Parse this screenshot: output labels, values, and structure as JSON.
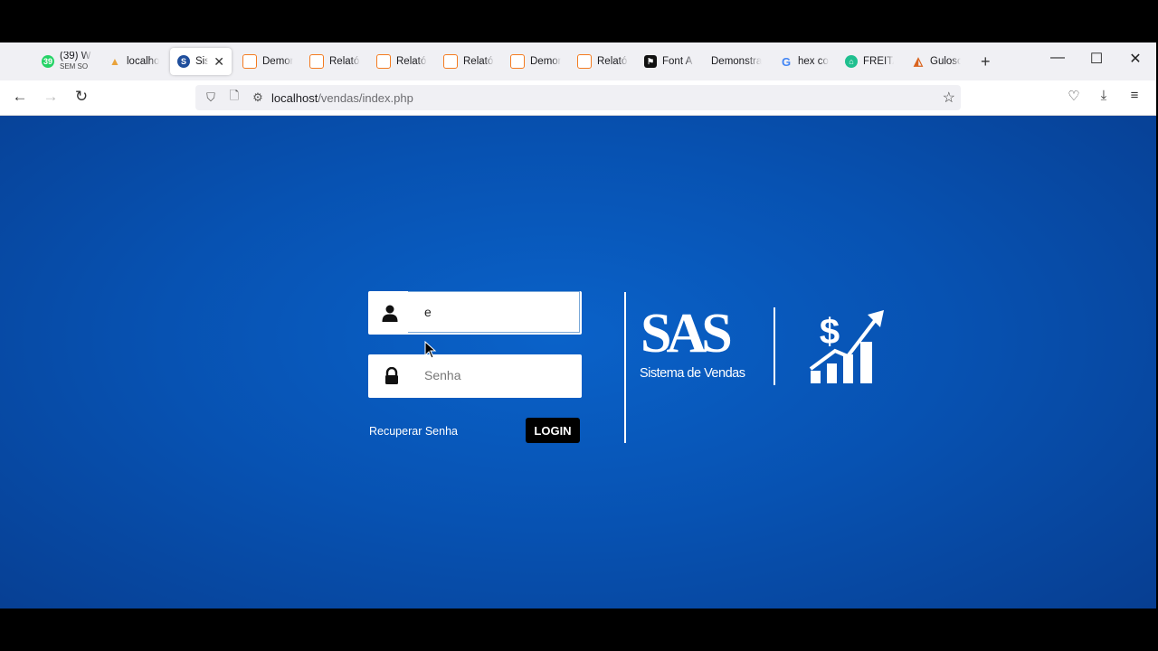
{
  "browser": {
    "tabs": [
      {
        "label": "(39) W",
        "sub": "SEM SO",
        "icon": "whatsapp-icon",
        "color": "#25d366"
      },
      {
        "label": "localho",
        "icon": "localhost-icon",
        "color": "#e9a23b"
      },
      {
        "label": "Siste",
        "icon": "sas-icon",
        "color": "#1f4e9c",
        "active": true
      },
      {
        "label": "Demor",
        "icon": "xampp-icon"
      },
      {
        "label": "Relató",
        "icon": "xampp-icon"
      },
      {
        "label": "Relató",
        "icon": "xampp-icon"
      },
      {
        "label": "Relató",
        "icon": "xampp-icon"
      },
      {
        "label": "Demor",
        "icon": "xampp-icon"
      },
      {
        "label": "Relató",
        "icon": "xampp-icon"
      },
      {
        "label": "Font A",
        "icon": "flag-icon"
      },
      {
        "label": "Demonstra",
        "icon": "none"
      },
      {
        "label": "hex co",
        "icon": "google-icon"
      },
      {
        "label": "FREITA",
        "icon": "freitas-icon",
        "color": "#1fbf8f"
      },
      {
        "label": "Gulosc",
        "icon": "pizza-icon",
        "color": "#d9631e"
      }
    ],
    "new_tab": "+",
    "url_host": "localhost",
    "url_path": "/vendas/index.php"
  },
  "login": {
    "user_value": "e",
    "password_placeholder": "Senha",
    "recover_label": "Recuperar Senha",
    "login_label": "LOGIN"
  },
  "brand": {
    "title": "SAS",
    "subtitle": "Sistema de Vendas",
    "accent": "#0a62c9"
  }
}
